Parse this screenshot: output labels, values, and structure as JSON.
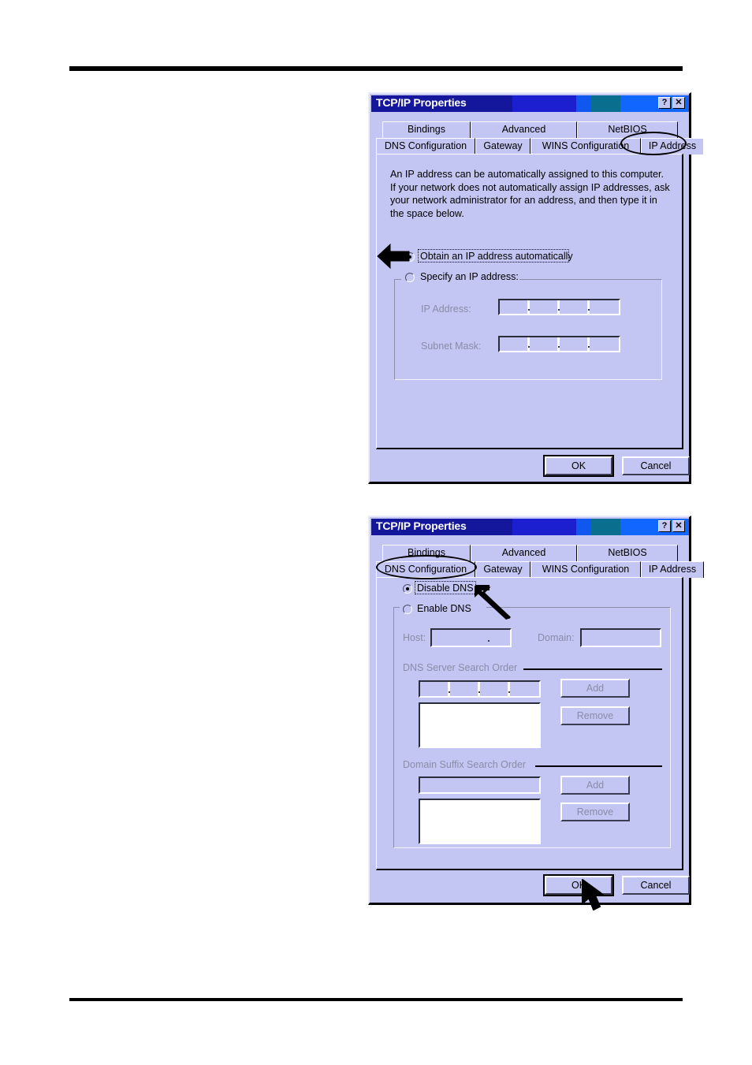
{
  "page": {
    "background": "#ffffff",
    "rule_color": "#000000"
  },
  "dialog1": {
    "title": "TCP/IP Properties",
    "title_buttons": [
      {
        "name": "help-button",
        "label": "?"
      },
      {
        "name": "close-button",
        "label": "✕"
      }
    ],
    "tabs_row1": [
      "Bindings",
      "Advanced",
      "NetBIOS"
    ],
    "tabs_row2": [
      "DNS Configuration",
      "Gateway",
      "WINS Configuration",
      "IP Address"
    ],
    "active_tab": "IP Address",
    "description": [
      "An IP address can be automatically assigned to this computer.",
      "If your network does not automatically assign IP addresses, ask",
      "your network administrator for an address, and then type it in",
      "the space below."
    ],
    "radio_auto": {
      "label": "Obtain an IP address automatically",
      "checked": true
    },
    "radio_specify": {
      "label": "Specify an IP address:",
      "checked": false
    },
    "ip_address_label": "IP Address:",
    "ip_address_value": "",
    "subnet_mask_label": "Subnet Mask:",
    "subnet_mask_value": "",
    "ok_label": "OK",
    "cancel_label": "Cancel",
    "annotation": "arrow pointing at Obtain an IP address automatically radio; ellipse around IP Address tab"
  },
  "dialog2": {
    "title": "TCP/IP Properties",
    "title_buttons": [
      {
        "name": "help-button",
        "label": "?"
      },
      {
        "name": "close-button",
        "label": "✕"
      }
    ],
    "tabs_row1": [
      "Bindings",
      "Advanced",
      "NetBIOS"
    ],
    "tabs_row2": [
      "DNS Configuration",
      "Gateway",
      "WINS Configuration",
      "IP Address"
    ],
    "active_tab": "DNS Configuration",
    "radio_disable": {
      "label": "Disable DNS",
      "checked": true
    },
    "radio_enable": {
      "label": "Enable DNS",
      "checked": false
    },
    "host_label": "Host:",
    "host_value": "",
    "domain_label": "Domain:",
    "domain_value": "",
    "dns_server_group": "DNS Server Search Order",
    "dns_server_entry": "",
    "dns_server_add": "Add",
    "dns_server_remove": "Remove",
    "dns_server_list": [],
    "domain_suffix_group": "Domain Suffix Search Order",
    "domain_suffix_entry": "",
    "domain_suffix_add": "Add",
    "domain_suffix_remove": "Remove",
    "domain_suffix_list": [],
    "ok_label": "OK",
    "cancel_label": "Cancel",
    "annotation": "arrow pointing at Disable DNS radio; ellipse around DNS Configuration tab; cursor on OK button"
  },
  "colors": {
    "dialog_face": "#c3c6f2",
    "titlebar_navy": "#14179c",
    "titlebar_blue": "#1166ff",
    "titlebar_teal": "#0a6f8f",
    "disabled_text": "#8a8ca8",
    "field_white": "#ffffff"
  }
}
